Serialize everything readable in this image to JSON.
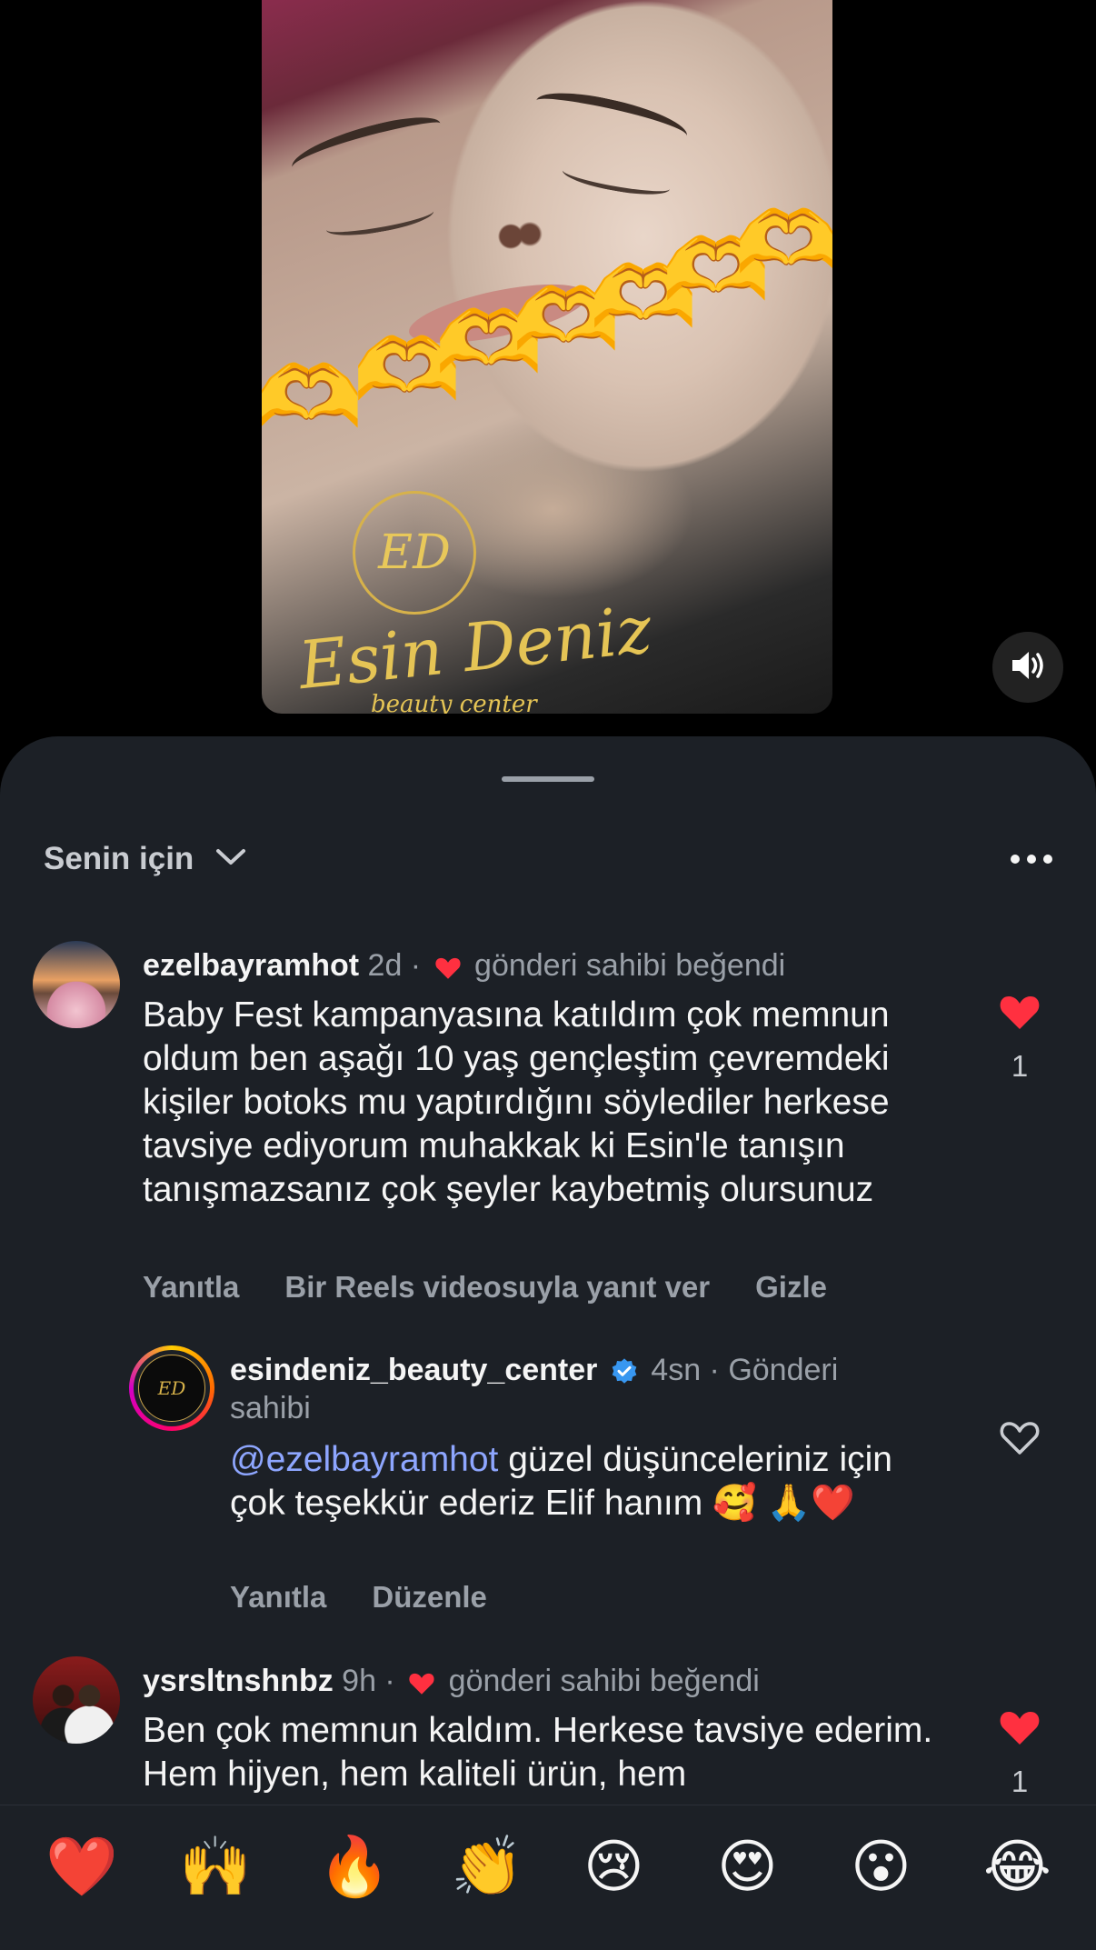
{
  "video": {
    "overlay_emoji": [
      "🫶",
      "🫶",
      "🫶",
      "🫶",
      "🫶",
      "🫶",
      "🫶"
    ],
    "watermark_monogram": "ED",
    "watermark_name": "Esin Deniz",
    "watermark_sub": "beauty center",
    "sound_icon": "speaker-icon"
  },
  "sheet": {
    "filter_label": "Senin için",
    "more_icon": "more-icon"
  },
  "comments": [
    {
      "username": "ezelbayramhot",
      "time": "2d ·",
      "liked_by_owner": "gönderi sahibi beğendi",
      "text": "Baby Fest kampanyasına katıldım çok memnun oldum ben aşağı 10 yaş gençleştim çevremdeki kişiler botoks mu yaptırdığını söylediler herkese tavsiye ediyorum muhakkak ki Esin'le tanışın tanışmazsanız çok şeyler kaybetmiş olursunuz",
      "like_count": "1",
      "actions": [
        "Yanıtla",
        "Bir Reels videosuyla yanıt ver",
        "Gizle"
      ]
    },
    {
      "username": "esindeniz_beauty_center",
      "time": "4sn · Gönderi",
      "time_cont": "sahibi",
      "mention": "@ezelbayramhot",
      "text": " güzel düşünceleriniz için çok teşekkür ederiz Elif hanım 🥰 🙏❤️",
      "actions": [
        "Yanıtla",
        "Düzenle"
      ]
    },
    {
      "username": "ysrsltnshnbz",
      "time": "9h ·",
      "liked_by_owner": "gönderi sahibi beğendi",
      "text": "Ben çok memnun kaldım. Herkese tavsiye ederim. Hem hijyen, hem kaliteli ürün, hem",
      "like_count": "1"
    }
  ],
  "reactions": [
    "❤️",
    "🙌",
    "🔥",
    "👏",
    "😢",
    "😍",
    "😮",
    "😂"
  ],
  "colors": {
    "sheet_bg": "#1c2026",
    "heart_red": "#ff3040",
    "mention_blue": "#8ea6ff",
    "verified_blue": "#3897f0",
    "muted_text": "#9aa0a8"
  }
}
